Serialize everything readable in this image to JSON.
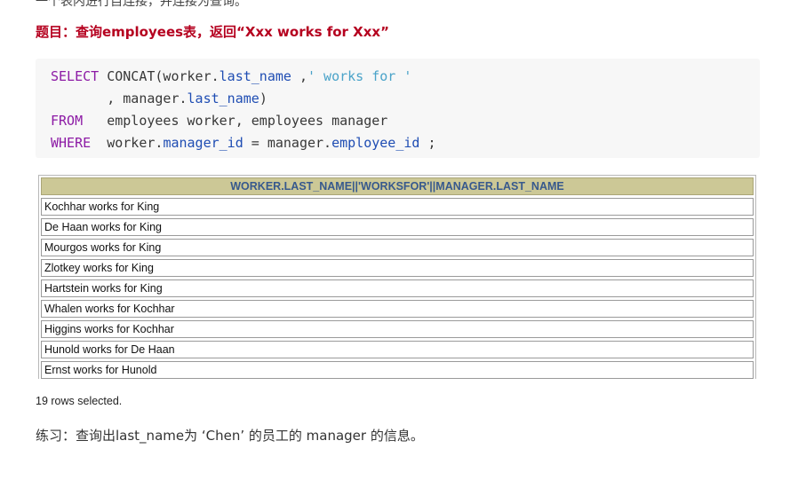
{
  "top_text": "一个表内进行自连接，并连接为查询。",
  "heading": "题目：查询employees表，返回“Xxx works for Xxx”",
  "code": {
    "line1": {
      "kw": "SELECT",
      "t1": " CONCAT(worker.",
      "f1": "last_name",
      "t2": " ,",
      "s1": "' works for '"
    },
    "line2": {
      "t1": "       , manager.",
      "f1": "last_name",
      "t2": ")"
    },
    "line3": {
      "kw": "FROM",
      "t1": "   employees worker, employees manager"
    },
    "line4": {
      "kw": "WHERE",
      "t1": "  worker.",
      "f1": "manager_id",
      "t2": " = manager.",
      "f2": "employee_id",
      "t3": " ;"
    }
  },
  "result": {
    "header": "WORKER.LAST_NAME||'WORKSFOR'||MANAGER.LAST_NAME",
    "rows": [
      "Kochhar works for King",
      "De Haan works for King",
      "Mourgos works for King",
      "Zlotkey works for King",
      "Hartstein works for King",
      "Whalen works for Kochhar",
      "Higgins works for Kochhar",
      "Hunold works for De Haan",
      "Ernst works for Hunold"
    ]
  },
  "rows_selected": "19 rows selected.",
  "exercise": "练习：查询出last_name为 ‘Chen’ 的员工的 manager 的信息。"
}
